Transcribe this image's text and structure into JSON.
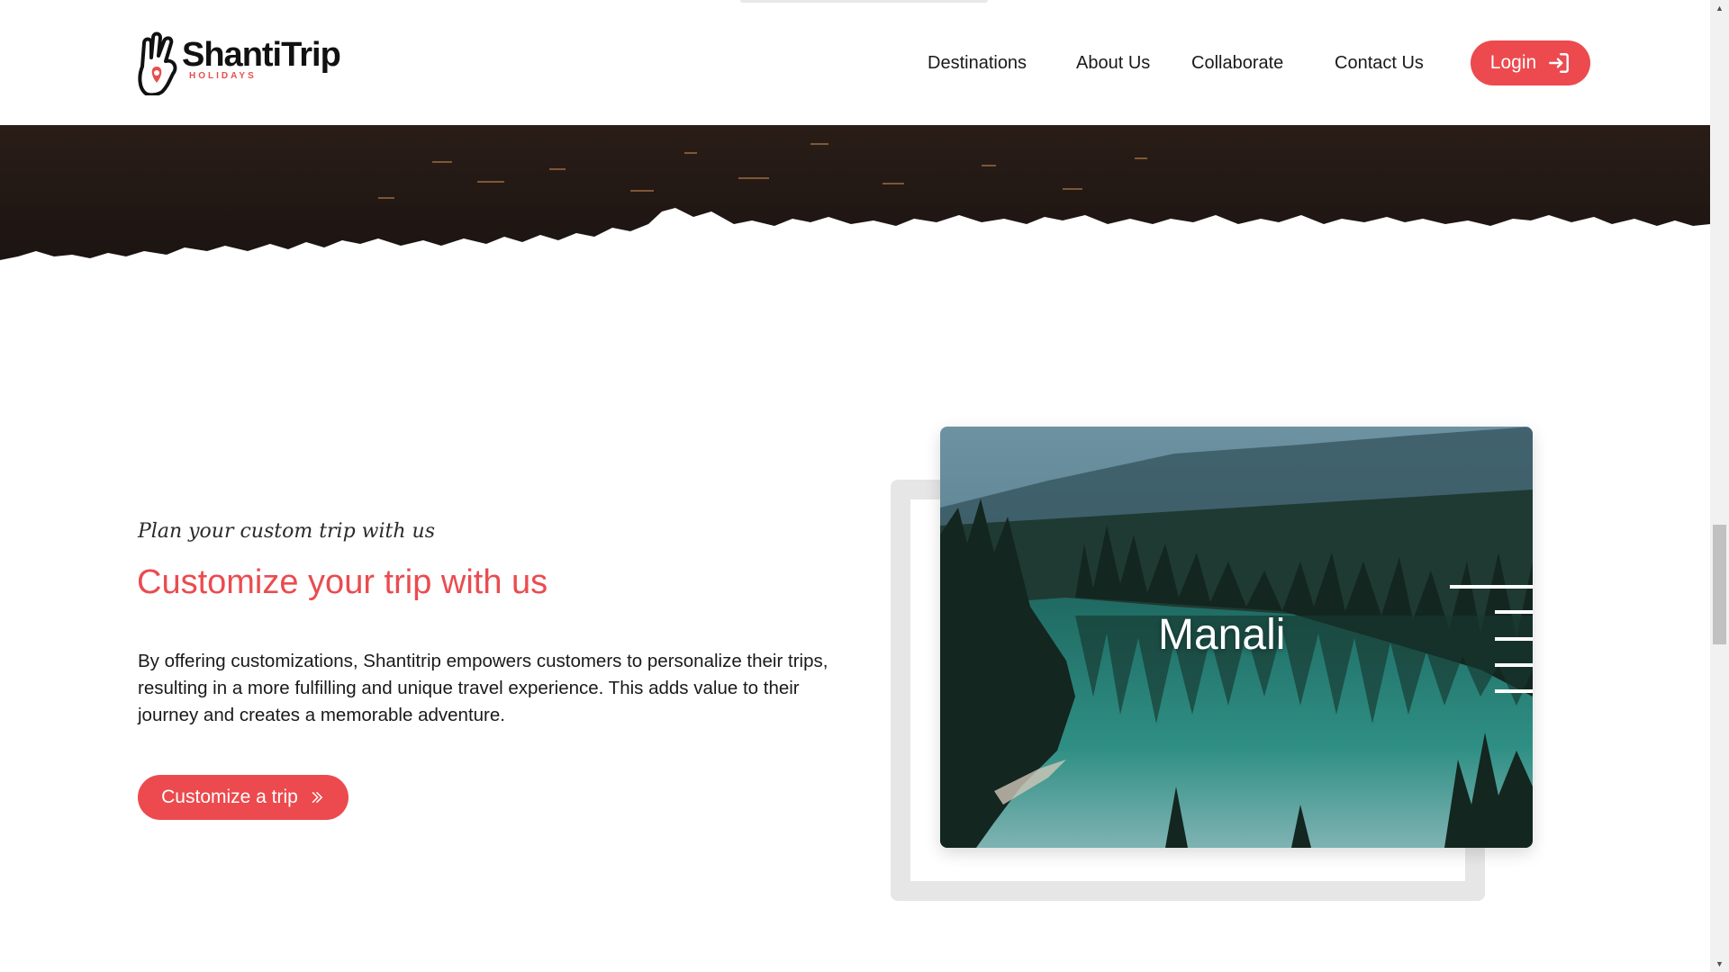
{
  "brand": {
    "name": "ShantiTrip",
    "subtitle": "HOLIDAYS",
    "logo_icon": "hand-pin-logo-icon",
    "accent_color": "#ec4a4e"
  },
  "nav": {
    "items": [
      {
        "label": "Destinations"
      },
      {
        "label": "About Us"
      },
      {
        "label": "Collaborate"
      },
      {
        "label": "Contact Us"
      }
    ],
    "login": {
      "label": "Login",
      "icon": "login-arrow-icon"
    }
  },
  "section": {
    "tagline": "Plan your custom trip with us",
    "title": "Customize your trip with us",
    "body": "By offering customizations, Shantitrip empowers customers to personalize their trips, resulting in a more fulfilling and unique travel experience. This adds value to their journey and creates a memorable adventure.",
    "cta": {
      "label": "Customize a trip",
      "icon": "double-chevron-right-icon"
    }
  },
  "feature_card": {
    "label": "Manali",
    "image": "forest-lake-photo",
    "menu_icon": "menu-lines-icon"
  }
}
